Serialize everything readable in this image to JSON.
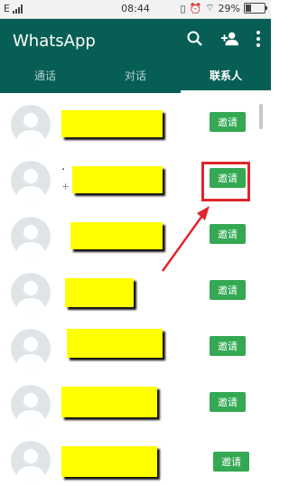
{
  "status_bar": {
    "carrier_icon": "E",
    "time": "08:44",
    "battery_percent": "29%",
    "battery_level": 0.29
  },
  "app_bar": {
    "title": "WhatsApp",
    "actions": [
      "search-icon",
      "add-contact-icon",
      "more-vert-icon"
    ]
  },
  "tabs": [
    {
      "label": "通话",
      "active": false
    },
    {
      "label": "对话",
      "active": false
    },
    {
      "label": "联系人",
      "active": true
    }
  ],
  "contacts": [
    {
      "name": "",
      "sub": "",
      "invite_label": "邀请"
    },
    {
      "name": "·",
      "sub": "+",
      "invite_label": "邀请"
    },
    {
      "name": "",
      "sub": "",
      "invite_label": "邀请"
    },
    {
      "name": "",
      "sub": "",
      "invite_label": "邀请"
    },
    {
      "name": "",
      "sub": "",
      "invite_label": "邀请"
    },
    {
      "name": "",
      "sub": "",
      "invite_label": "邀请"
    },
    {
      "name": "",
      "sub": "",
      "invite_label": "邀请"
    }
  ],
  "colors": {
    "app_bar": "#075e54",
    "invite_button": "#34a853",
    "highlight": "#e0262e",
    "redaction": "#ffff00"
  }
}
